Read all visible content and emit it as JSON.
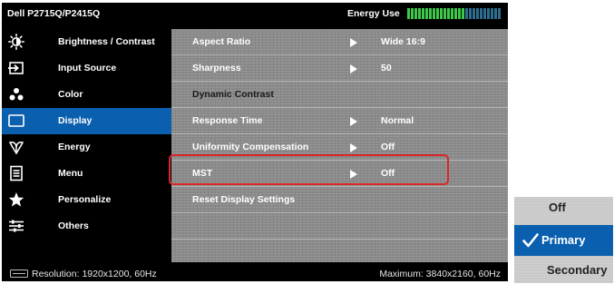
{
  "osd": {
    "model": "Dell P2715Q/P2415Q",
    "energy_label": "Energy Use",
    "energy_level": 0.62,
    "colors": {
      "energy_active": "#3ec94a",
      "energy_inactive": "#2e6d8f",
      "sidebar_active": "#0a5fae",
      "highlight_border": "#d9272a"
    },
    "sidebar": {
      "items": [
        {
          "label": "Brightness / Contrast",
          "icon": "brightness-icon",
          "active": false
        },
        {
          "label": "Input Source",
          "icon": "input-source-icon",
          "active": false
        },
        {
          "label": "Color",
          "icon": "color-icon",
          "active": false
        },
        {
          "label": "Display",
          "icon": "display-icon",
          "active": true
        },
        {
          "label": "Energy",
          "icon": "energy-icon",
          "active": false
        },
        {
          "label": "Menu",
          "icon": "menu-icon",
          "active": false
        },
        {
          "label": "Personalize",
          "icon": "star-icon",
          "active": false
        },
        {
          "label": "Others",
          "icon": "sliders-icon",
          "active": false
        }
      ]
    },
    "main": {
      "rows": [
        {
          "label": "Aspect Ratio",
          "value": "Wide 16:9",
          "has_arrow": true
        },
        {
          "label": "Sharpness",
          "value": "50",
          "has_arrow": true
        },
        {
          "label": "Dynamic Contrast",
          "value": "",
          "has_arrow": false,
          "dimmed": true
        },
        {
          "label": "Response Time",
          "value": "Normal",
          "has_arrow": true
        },
        {
          "label": "Uniformity Compensation",
          "value": "Off",
          "has_arrow": true
        },
        {
          "label": "MST",
          "value": "Off",
          "has_arrow": true,
          "highlighted": true
        },
        {
          "label": "Reset Display Settings",
          "value": "",
          "has_arrow": false
        }
      ]
    },
    "footer": {
      "resolution": "Resolution: 1920x1200, 60Hz",
      "maximum": "Maximum: 3840x2160, 60Hz"
    }
  },
  "mst_dropdown": {
    "options": [
      {
        "label": "Off",
        "selected": false
      },
      {
        "label": "Primary",
        "selected": true
      },
      {
        "label": "Secondary",
        "selected": false
      }
    ]
  }
}
